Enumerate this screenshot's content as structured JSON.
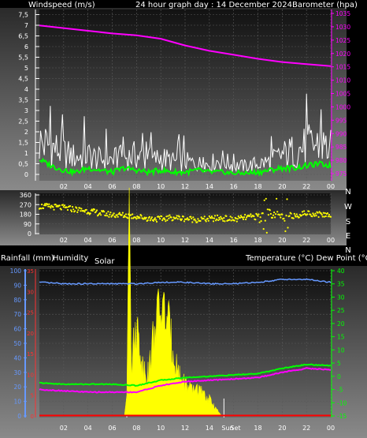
{
  "header": {
    "left": "Windspeed (m/s)",
    "center": "24 hour graph day : 14 December 2024",
    "right": "Barometer (hpa)"
  },
  "labels_mid": {
    "left": "Rainfall (mm)",
    "humidity": "Humidity",
    "solar": "Solar",
    "right": "Temperature (°C) Dew Point (°C)"
  },
  "colors": {
    "wind": "#ffffff",
    "gust_avg": "#00ff00",
    "barometer": "#ff00ff",
    "direction": "#ffff00",
    "humidity": "#6699ff",
    "temperature": "#00ff00",
    "dewpoint": "#ff00ff",
    "solar": "#ffff00",
    "rain": "#ff0000"
  },
  "chart_data": [
    {
      "type": "line",
      "title": "24 hour graph day : 14 December 2024",
      "ylabel": "Windspeed (m/s)",
      "y2label": "Barometer (hpa)",
      "x_ticks": [
        "02",
        "04",
        "06",
        "08",
        "10",
        "12",
        "14",
        "16",
        "18",
        "20",
        "22",
        "00"
      ],
      "ylim": [
        0,
        8
      ],
      "y_ticks": [
        "0",
        "0,5",
        "1",
        "1,5",
        "2",
        "2,5",
        "3",
        "3,5",
        "4",
        "4,5",
        "5",
        "5,5",
        "6",
        "6,5",
        "7",
        "7,5"
      ],
      "y2lim": [
        973,
        1037
      ],
      "y2_ticks": [
        "975",
        "980",
        "985",
        "990",
        "995",
        "1000",
        "1005",
        "1010",
        "1015",
        "1020",
        "1025",
        "1030",
        "1035"
      ],
      "series": [
        {
          "key": "wind",
          "x": [
            0,
            1,
            2,
            3,
            4,
            5,
            6,
            7,
            8,
            9,
            10,
            11,
            12,
            13,
            14,
            15,
            16,
            17,
            18,
            19,
            20,
            21,
            22,
            23,
            24
          ],
          "values": [
            1.5,
            1.3,
            1.0,
            0.8,
            0.9,
            0.7,
            0.7,
            0.8,
            0.9,
            0.6,
            0.8,
            0.6,
            0.6,
            0.5,
            0.5,
            0.7,
            0.4,
            0.4,
            0.5,
            0.6,
            0.9,
            1.1,
            1.3,
            1.4,
            1.2
          ]
        },
        {
          "key": "gust_avg",
          "x": [
            0,
            1,
            2,
            3,
            4,
            5,
            6,
            7,
            8,
            9,
            10,
            11,
            12,
            13,
            14,
            15,
            16,
            17,
            18,
            19,
            20,
            21,
            22,
            23,
            24
          ],
          "values": [
            0.7,
            0.4,
            0.2,
            0.1,
            0.3,
            0.2,
            0.1,
            0.3,
            0.2,
            0.1,
            0.2,
            0.1,
            0.1,
            0.2,
            0.1,
            0.1,
            0.05,
            0.05,
            0.1,
            0.2,
            0.3,
            0.3,
            0.4,
            0.5,
            0.4
          ]
        },
        {
          "key": "barometer",
          "x": [
            0,
            2,
            4,
            6,
            8,
            10,
            12,
            14,
            16,
            18,
            20,
            22,
            24
          ],
          "values": [
            1030.5,
            1029.5,
            1028.5,
            1027.5,
            1026.8,
            1025.5,
            1023.0,
            1021.0,
            1019.5,
            1018.0,
            1016.8,
            1016.0,
            1015.3
          ]
        }
      ]
    },
    {
      "type": "scatter",
      "ylabel": "Wind direction",
      "x_ticks": [
        "02",
        "04",
        "06",
        "08",
        "10",
        "12",
        "14",
        "16",
        "18",
        "20",
        "22",
        "00"
      ],
      "ylim": [
        0,
        360
      ],
      "y_ticks": [
        "0",
        "90",
        "180",
        "270",
        "360"
      ],
      "compass": [
        "N",
        "W",
        "S",
        "E",
        "N"
      ],
      "series": [
        {
          "key": "direction",
          "x": [
            0,
            1,
            2,
            3,
            4,
            5,
            6,
            7,
            8,
            9,
            10,
            11,
            12,
            13,
            14,
            15,
            16,
            17,
            18,
            19,
            20,
            21,
            22,
            23,
            24
          ],
          "values": [
            255,
            250,
            240,
            225,
            210,
            190,
            175,
            170,
            160,
            140,
            135,
            150,
            140,
            130,
            135,
            145,
            130,
            150,
            160,
            210,
            160,
            170,
            190,
            180,
            175
          ]
        }
      ]
    },
    {
      "type": "line",
      "x_ticks": [
        "02",
        "04",
        "06",
        "08",
        "10",
        "12",
        "14",
        "16",
        "18",
        "20",
        "22",
        "00"
      ],
      "ylim": [
        0,
        100
      ],
      "y_ticks": [
        "0",
        "10",
        "20",
        "30",
        "40",
        "50",
        "60",
        "70",
        "80",
        "90",
        "100"
      ],
      "y_mid_ticks": [
        "0",
        "5",
        "10",
        "15",
        "20",
        "25",
        "30",
        "35"
      ],
      "y2lim": [
        -15,
        40
      ],
      "y2_ticks": [
        "-15",
        "-10",
        "-5",
        "0",
        "5",
        "10",
        "15",
        "20",
        "25",
        "30",
        "35",
        "40"
      ],
      "sun_markers": [
        "Sun",
        "Set"
      ],
      "series": [
        {
          "key": "humidity",
          "x": [
            0,
            2,
            4,
            6,
            8,
            10,
            12,
            14,
            16,
            18,
            20,
            22,
            24
          ],
          "values": [
            92,
            91,
            91,
            91,
            91,
            92,
            92,
            91,
            91,
            92,
            94,
            94,
            92
          ]
        },
        {
          "key": "temperature",
          "x": [
            0,
            2,
            4,
            6,
            8,
            10,
            12,
            14,
            16,
            18,
            20,
            22,
            24
          ],
          "values": [
            -2.5,
            -3,
            -3,
            -3,
            -3.5,
            -1.5,
            -0.5,
            0,
            0.5,
            1,
            3,
            4.5,
            4
          ]
        },
        {
          "key": "dewpoint",
          "x": [
            0,
            2,
            4,
            6,
            8,
            10,
            12,
            14,
            16,
            18,
            20,
            22,
            24
          ],
          "values": [
            -5,
            -5.5,
            -6,
            -6,
            -6,
            -3.5,
            -2,
            -1.5,
            -1,
            -0.5,
            1.5,
            3,
            2.5
          ]
        },
        {
          "key": "solar",
          "x": [
            7.0,
            7.2,
            7.4,
            7.6,
            7.8,
            8.0,
            8.5,
            9.0,
            9.5,
            10.0,
            10.5,
            11.0,
            11.5,
            12.0,
            12.5,
            13.0,
            13.5,
            14.0,
            14.5,
            15.0
          ],
          "values": [
            0,
            5,
            55,
            12,
            18,
            22,
            12,
            10,
            22,
            26,
            24,
            16,
            10,
            8,
            6,
            7,
            5,
            4,
            2,
            0
          ]
        },
        {
          "key": "rain",
          "x": [
            0,
            24
          ],
          "values": [
            0,
            0
          ]
        }
      ]
    }
  ]
}
